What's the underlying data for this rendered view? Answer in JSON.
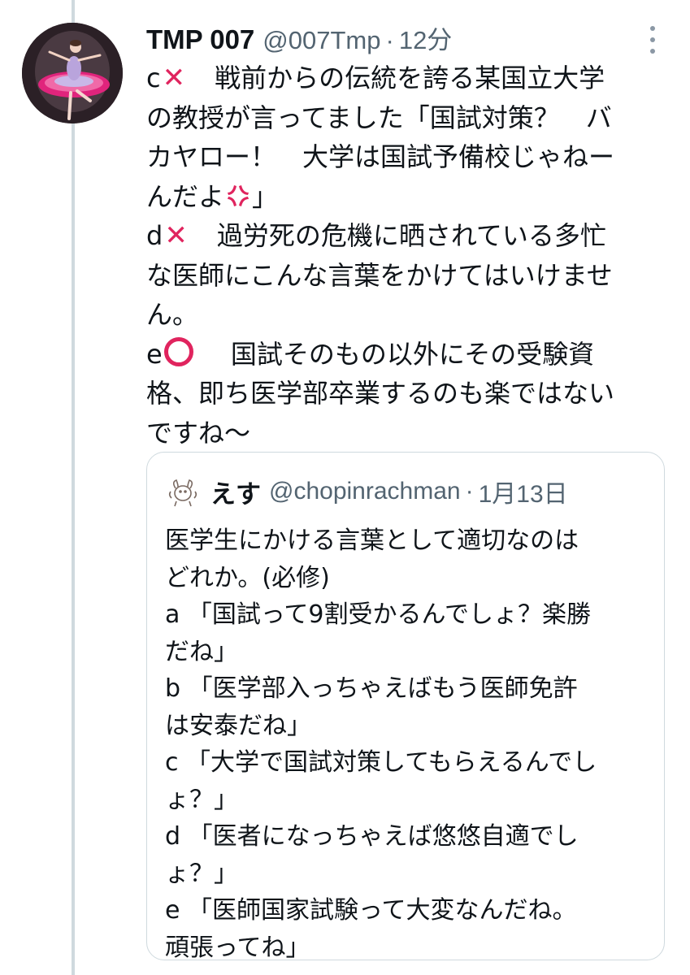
{
  "tweet": {
    "author": {
      "display_name": "TMP 007",
      "handle": "@007Tmp"
    },
    "separator": "·",
    "timestamp": "12分",
    "items": [
      {
        "letter": "c",
        "mark_icon": "cross-mark-icon",
        "lines": [
          "　戦前からの伝統を誇る某国立大学",
          "の教授が言ってました「国試対策？　バ",
          "カヤロー！　大学は国試予備校じゃねー",
          "んだよ"
        ],
        "line_end": "」",
        "emoji_icon": "anger-symbol-icon"
      },
      {
        "letter": "d",
        "mark_icon": "cross-mark-icon",
        "lines": [
          "　過労死の危機に晒されている多忙",
          "な医師にこんな言葉をかけてはいけませ",
          "ん。"
        ]
      },
      {
        "letter": "e",
        "mark_icon": "circle-mark-icon",
        "lines": [
          "　 国試そのもの以外にその受験資",
          "格、即ち医学部卒業するのも楽ではない",
          "ですね～"
        ]
      }
    ],
    "colors": {
      "text": "#0f1419",
      "secondary": "#536471",
      "mark": "#e0245e"
    }
  },
  "quote": {
    "author": {
      "display_name": "えす",
      "handle": "@chopinrachman"
    },
    "separator": "·",
    "timestamp": "1月13日",
    "lines": [
      "医学生にかける言葉として適切なのは",
      "どれか。(必修)",
      "a 「国試って9割受かるんでしょ？楽勝",
      "だね」",
      "b 「医学部入っちゃえばもう医師免許",
      "は安泰だね」",
      "c 「大学で国試対策してもらえるんでし",
      "ょ？」",
      "d 「医者になっちゃえば悠悠自適でし",
      "ょ？」",
      "e 「医師国家試験って大変なんだね。",
      "頑張ってね」"
    ]
  }
}
